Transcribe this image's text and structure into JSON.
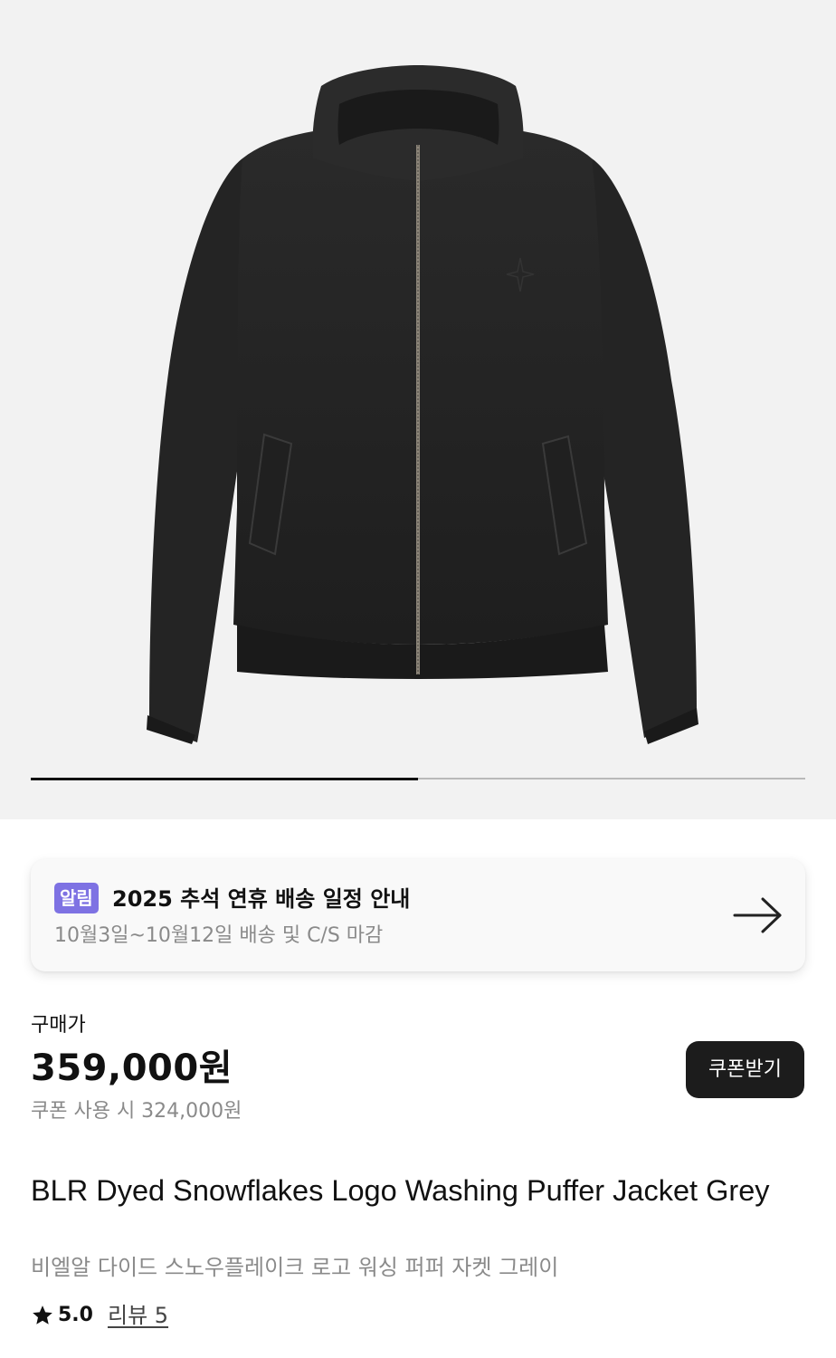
{
  "gallery": {
    "image": "product-jacket-image",
    "slide_progress": 0.5
  },
  "notice": {
    "badge": "알림",
    "title": "2025 추석 연휴 배송 일정 안내",
    "subtitle": "10월3일~10월12일 배송 및 C/S 마감",
    "arrow_icon": "arrow-right-icon"
  },
  "price": {
    "label": "구매가",
    "amount": "359,000원",
    "coupon_text": "쿠폰 사용 시 324,000원",
    "coupon_button": "쿠폰받기"
  },
  "product": {
    "title": "BLR Dyed Snowflakes Logo Washing Puffer Jacket Grey",
    "subtitle": "비엘알 다이드 스노우플레이크 로고 워싱 퍼퍼 자켓 그레이",
    "rating": "5.0",
    "review_link": "리뷰 5"
  },
  "colors": {
    "badge": "#7e72e3",
    "button": "#1c1c1c",
    "muted_text": "#8a8a8a"
  }
}
